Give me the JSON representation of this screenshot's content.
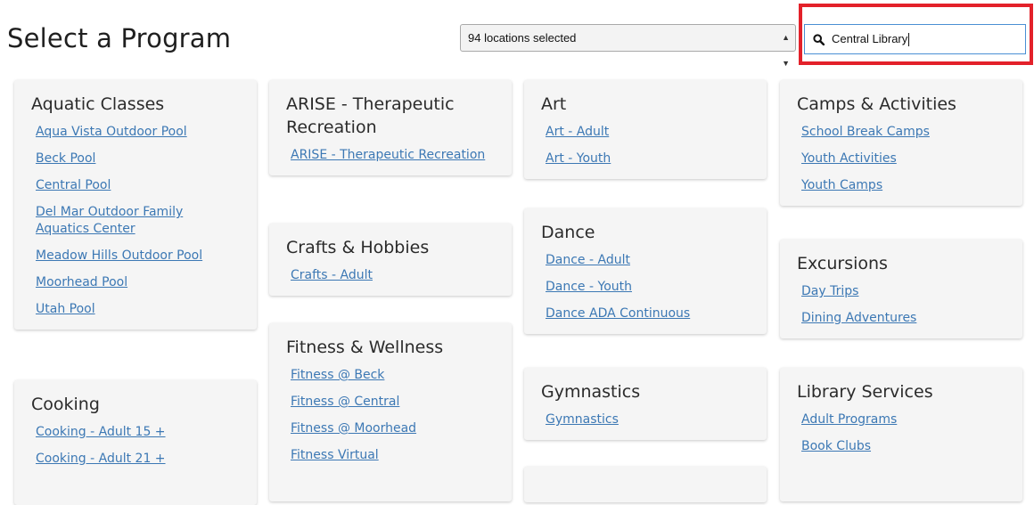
{
  "header": {
    "title": "Select a Program",
    "location_select": "94 locations selected",
    "search_value": "Central Library"
  },
  "columns": [
    [
      {
        "title": "Aquatic Classes",
        "links": [
          "Aqua Vista Outdoor Pool",
          "Beck Pool",
          "Central Pool",
          "Del Mar Outdoor Family Aquatics Center",
          "Meadow Hills Outdoor Pool",
          "Moorhead Pool",
          "Utah Pool"
        ]
      },
      {
        "title": "Cooking",
        "links": [
          "Cooking - Adult 15 +",
          "Cooking - Adult 21 +"
        ]
      }
    ],
    [
      {
        "title": "ARISE - Therapeutic Recreation",
        "links": [
          "ARISE - Therapeutic Recreation"
        ]
      },
      {
        "title": "Crafts & Hobbies",
        "links": [
          "Crafts - Adult"
        ]
      },
      {
        "title": "Fitness & Wellness",
        "links": [
          "Fitness @ Beck",
          "Fitness @ Central",
          "Fitness @ Moorhead",
          "Fitness Virtual"
        ]
      }
    ],
    [
      {
        "title": "Art",
        "links": [
          "Art - Adult",
          "Art - Youth"
        ]
      },
      {
        "title": "Dance",
        "links": [
          "Dance - Adult",
          "Dance - Youth",
          "Dance ADA Continuous"
        ]
      },
      {
        "title": "Gymnastics",
        "links": [
          "Gymnastics"
        ]
      },
      {
        "title": "",
        "links": []
      }
    ],
    [
      {
        "title": "Camps & Activities",
        "links": [
          "School Break Camps",
          "Youth Activities",
          "Youth Camps"
        ]
      },
      {
        "title": "Excursions",
        "links": [
          "Day Trips",
          "Dining Adventures"
        ]
      },
      {
        "title": "Library Services",
        "links": [
          "Adult Programs",
          "Book Clubs"
        ]
      }
    ]
  ]
}
